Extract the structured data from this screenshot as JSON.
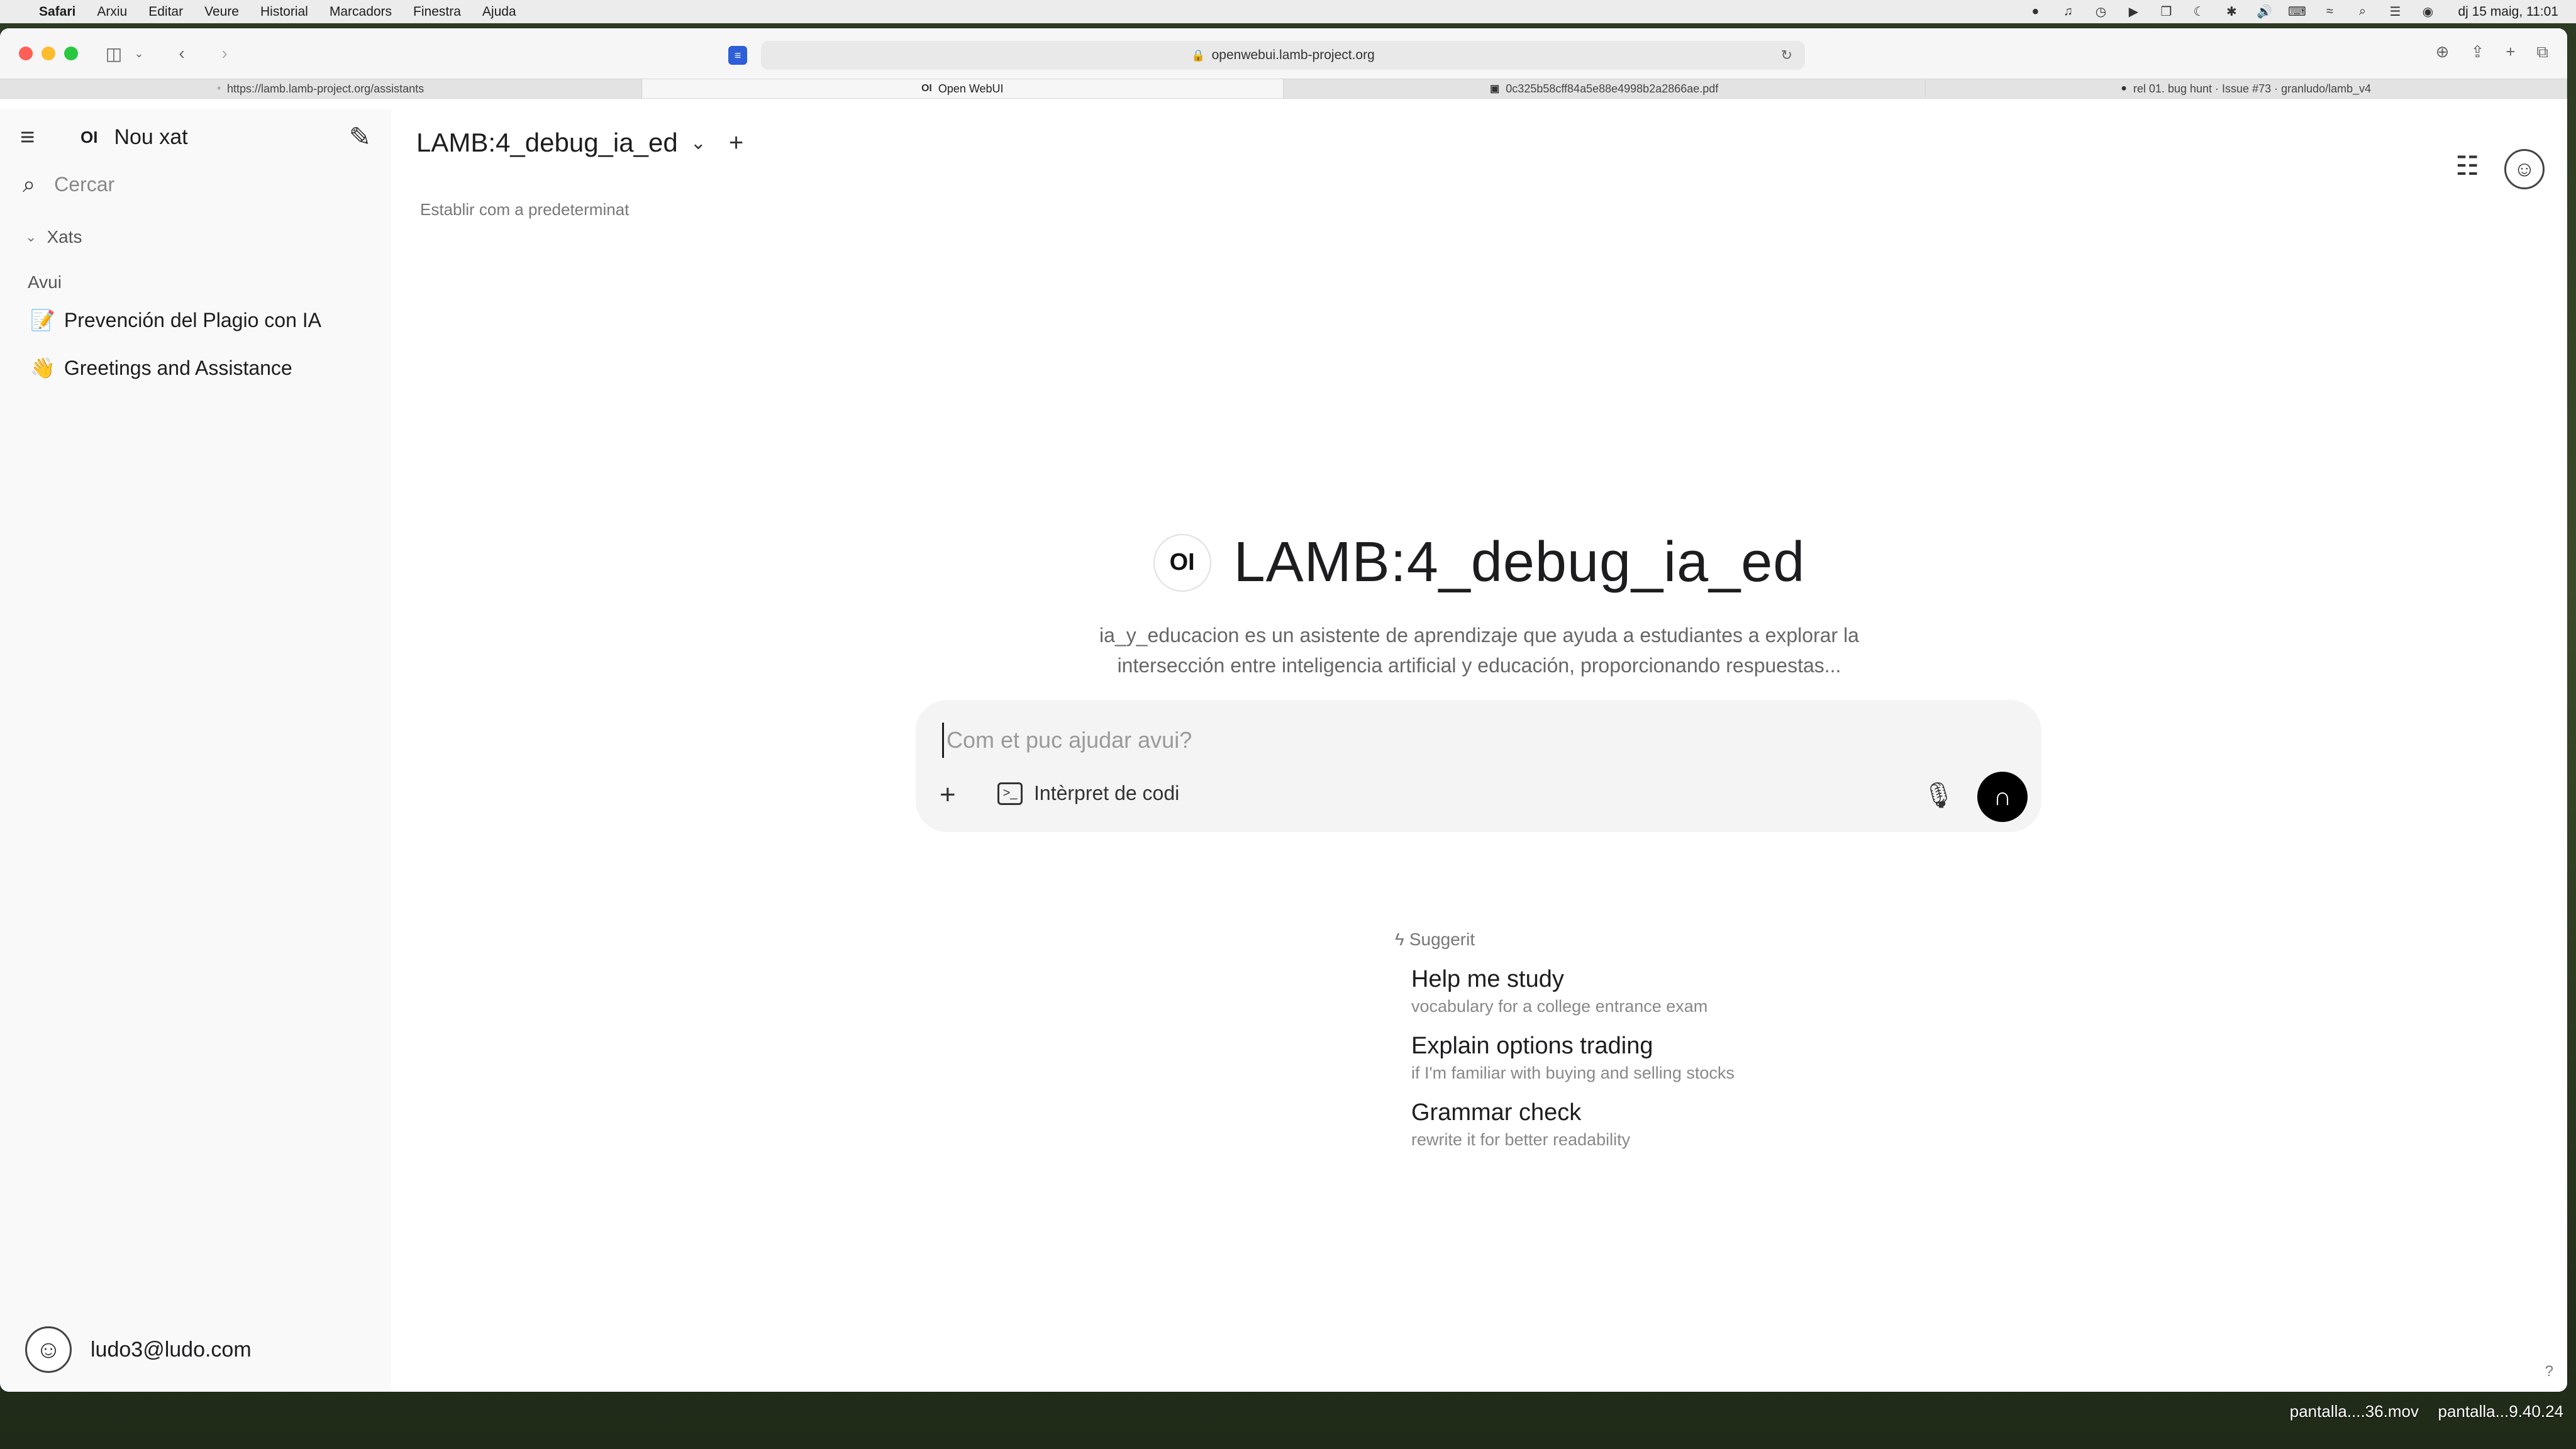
{
  "menubar": {
    "app": "Safari",
    "items": [
      "Arxiu",
      "Editar",
      "Veure",
      "Historial",
      "Marcadors",
      "Finestra",
      "Ajuda"
    ],
    "clock": "dj 15 maig, 11:01"
  },
  "browser": {
    "url": "openwebui.lamb-project.org",
    "tabs": [
      {
        "label": "https://lamb.lamb-project.org/assistants",
        "icon": "blank-favicon"
      },
      {
        "label": "Open WebUI",
        "icon": "oi-favicon"
      },
      {
        "label": "0c325b58cff84a5e88e4998b2a2866ae.pdf",
        "icon": "pdf-favicon"
      },
      {
        "label": "rel 01. bug hunt · Issue #73 · granludo/lamb_v4",
        "icon": "github-favicon"
      }
    ]
  },
  "sidebar": {
    "logo": "OI",
    "new_chat": "Nou xat",
    "search_placeholder": "Cercar",
    "section": "Xats",
    "group": "Avui",
    "chats": [
      {
        "emoji": "📝",
        "title": "Prevención del Plagio con IA"
      },
      {
        "emoji": "👋",
        "title": "Greetings and Assistance"
      }
    ],
    "user_email": "ludo3@ludo.com"
  },
  "main": {
    "model": "LAMB:4_debug_ia_ed",
    "set_default": "Establir com a predeterminat",
    "hero_logo": "OI",
    "hero_title": "LAMB:4_debug_ia_ed",
    "hero_desc": "ia_y_educacion es un asistente de aprendizaje que ayuda a estudiantes a explorar la intersección entre inteligencia artificial y educación, proporcionando respuestas...",
    "input_placeholder": "Com et puc ajudar avui?",
    "interpreter": "Intèrpret de codi",
    "suggested_label": "Suggerit",
    "suggestions": [
      {
        "title": "Help me study",
        "subtitle": "vocabulary for a college entrance exam"
      },
      {
        "title": "Explain options trading",
        "subtitle": "if I'm familiar with buying and selling stocks"
      },
      {
        "title": "Grammar check",
        "subtitle": "rewrite it for better readability"
      }
    ],
    "help": "?"
  },
  "desktop": {
    "files": [
      "pantalla....36.mov",
      "pantalla...9.40.24"
    ]
  }
}
